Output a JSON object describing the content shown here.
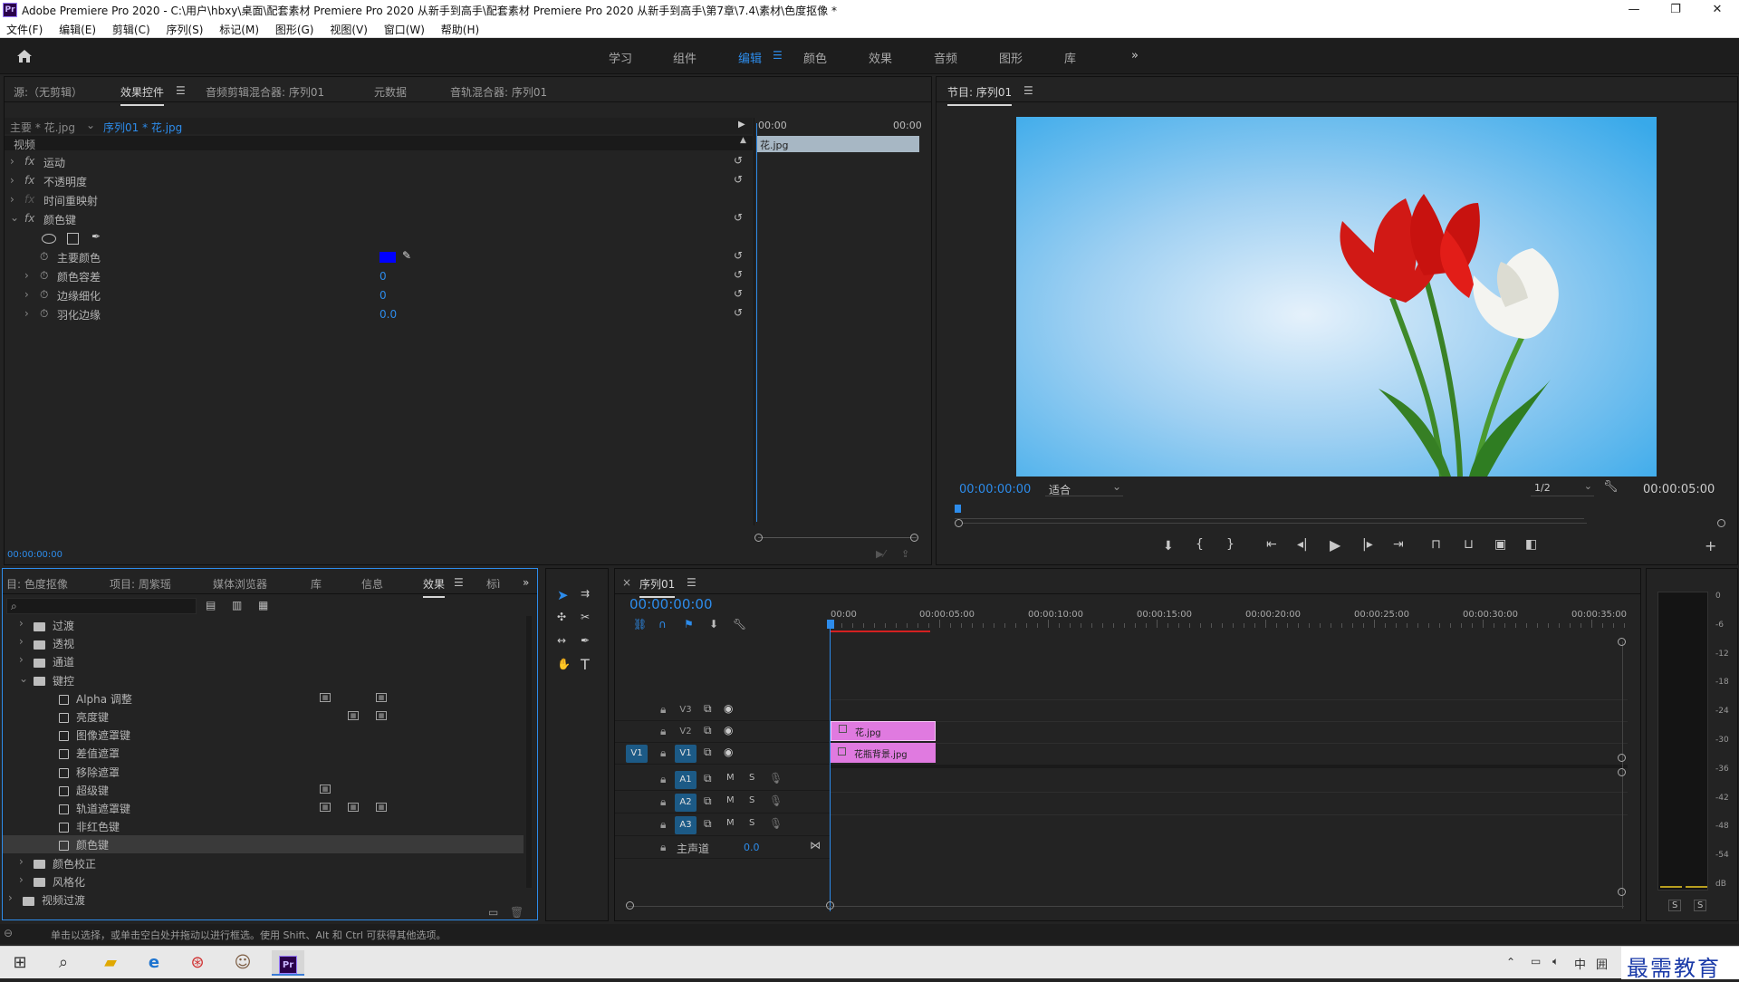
{
  "window": {
    "app_icon": "Pr",
    "title": "Adobe Premiere Pro 2020 - C:\\用户\\hbxy\\桌面\\配套素材 Premiere Pro 2020 从新手到高手\\配套素材 Premiere Pro 2020 从新手到高手\\第7章\\7.4\\素材\\色度抠像 *",
    "controls": [
      "—",
      "❐",
      "✕"
    ]
  },
  "menu": [
    "文件(F)",
    "编辑(E)",
    "剪辑(C)",
    "序列(S)",
    "标记(M)",
    "图形(G)",
    "视图(V)",
    "窗口(W)",
    "帮助(H)"
  ],
  "workspaces": {
    "items": [
      "学习",
      "组件",
      "编辑",
      "颜色",
      "效果",
      "音频",
      "图形",
      "库"
    ],
    "active": "编辑",
    "more": "»"
  },
  "source_panel": {
    "tabs": [
      "源:（无剪辑）",
      "效果控件",
      "音频剪辑混合器: 序列01",
      "元数据",
      "音轨混合器: 序列01"
    ],
    "active_tab": "效果控件",
    "master_clip": "主要 * 花.jpg",
    "sequence_clip": "序列01 * 花.jpg",
    "mini_time_start": "00:00",
    "mini_time_end": "00:00",
    "mini_clip_label": "花.jpg",
    "section_video": "视频",
    "effects": [
      {
        "label": "运动",
        "fx": "fx"
      },
      {
        "label": "不透明度",
        "fx": "fx"
      },
      {
        "label": "时间重映射",
        "fx": "fx"
      },
      {
        "label": "颜色键",
        "fx": "fx"
      }
    ],
    "params": [
      {
        "label": "主要颜色",
        "value": ""
      },
      {
        "label": "颜色容差",
        "value": "0"
      },
      {
        "label": "边缘细化",
        "value": "0"
      },
      {
        "label": "羽化边缘",
        "value": "0.0"
      }
    ],
    "key_color": "#0000ff",
    "timecode": "00:00:00:00"
  },
  "program_monitor": {
    "title": "节目: 序列01",
    "timecode": "00:00:00:00",
    "fit": "适合",
    "resolution": "1/2",
    "duration": "00:00:05:00"
  },
  "project_panel": {
    "tabs": [
      "目: 色度抠像",
      "项目: 周紫瑶",
      "媒体浏览器",
      "库",
      "信息",
      "效果",
      "标ì"
    ],
    "active_tab": "效果",
    "search_placeholder": "",
    "tree": [
      {
        "type": "folder",
        "label": "过渡",
        "level": 1,
        "open": false
      },
      {
        "type": "folder",
        "label": "透视",
        "level": 1,
        "open": false
      },
      {
        "type": "folder",
        "label": "通道",
        "level": 1,
        "open": false
      },
      {
        "type": "folder",
        "label": "键控",
        "level": 1,
        "open": true
      },
      {
        "type": "effect",
        "label": "Alpha 调整",
        "level": 2,
        "badges": [
          1,
          3
        ]
      },
      {
        "type": "effect",
        "label": "亮度键",
        "level": 2,
        "badges": [
          2,
          3
        ]
      },
      {
        "type": "effect",
        "label": "图像遮罩键",
        "level": 2,
        "badges": []
      },
      {
        "type": "effect",
        "label": "差值遮罩",
        "level": 2,
        "badges": []
      },
      {
        "type": "effect",
        "label": "移除遮罩",
        "level": 2,
        "badges": []
      },
      {
        "type": "effect",
        "label": "超级键",
        "level": 2,
        "badges": [
          1
        ]
      },
      {
        "type": "effect",
        "label": "轨道遮罩键",
        "level": 2,
        "badges": [
          1,
          2,
          3
        ]
      },
      {
        "type": "effect",
        "label": "非红色键",
        "level": 2,
        "badges": []
      },
      {
        "type": "effect",
        "label": "颜色键",
        "level": 2,
        "badges": [],
        "selected": true
      },
      {
        "type": "folder",
        "label": "颜色校正",
        "level": 1,
        "open": false
      },
      {
        "type": "folder",
        "label": "风格化",
        "level": 1,
        "open": false
      },
      {
        "type": "folder",
        "label": "视频过渡",
        "level": 0,
        "open": false
      }
    ]
  },
  "timeline": {
    "tab": "序列01",
    "timecode": "00:00:00:00",
    "ruler": [
      "00:00",
      "00:00:05:00",
      "00:00:10:00",
      "00:00:15:00",
      "00:00:20:00",
      "00:00:25:00",
      "00:00:30:00",
      "00:00:35:00"
    ],
    "video_tracks": [
      "V3",
      "V2",
      "V1"
    ],
    "audio_tracks": [
      "A1",
      "A2",
      "A3"
    ],
    "source_patch_v": "V1",
    "mute": "M",
    "solo": "S",
    "master_label": "主声道",
    "master_value": "0.0",
    "clips": [
      {
        "track": "V2",
        "label": "花.jpg"
      },
      {
        "track": "V1",
        "label": "花瓶背景.jpg"
      }
    ],
    "clip_color": "#e07ae0"
  },
  "audio_meter": {
    "scale": [
      "0",
      "-6",
      "-12",
      "-18",
      "-24",
      "-30",
      "-36",
      "-42",
      "-48",
      "-54",
      "dB"
    ],
    "solo_buttons": [
      "S",
      "S"
    ]
  },
  "status": {
    "text": "单击以选择，或单击空白处并拖动以进行框选。使用 Shift、Alt 和 Ctrl 可获得其他选项。"
  },
  "taskbar": {
    "tray_ime": "中",
    "tray_ime2": "囲",
    "watermark": "最需教育"
  }
}
